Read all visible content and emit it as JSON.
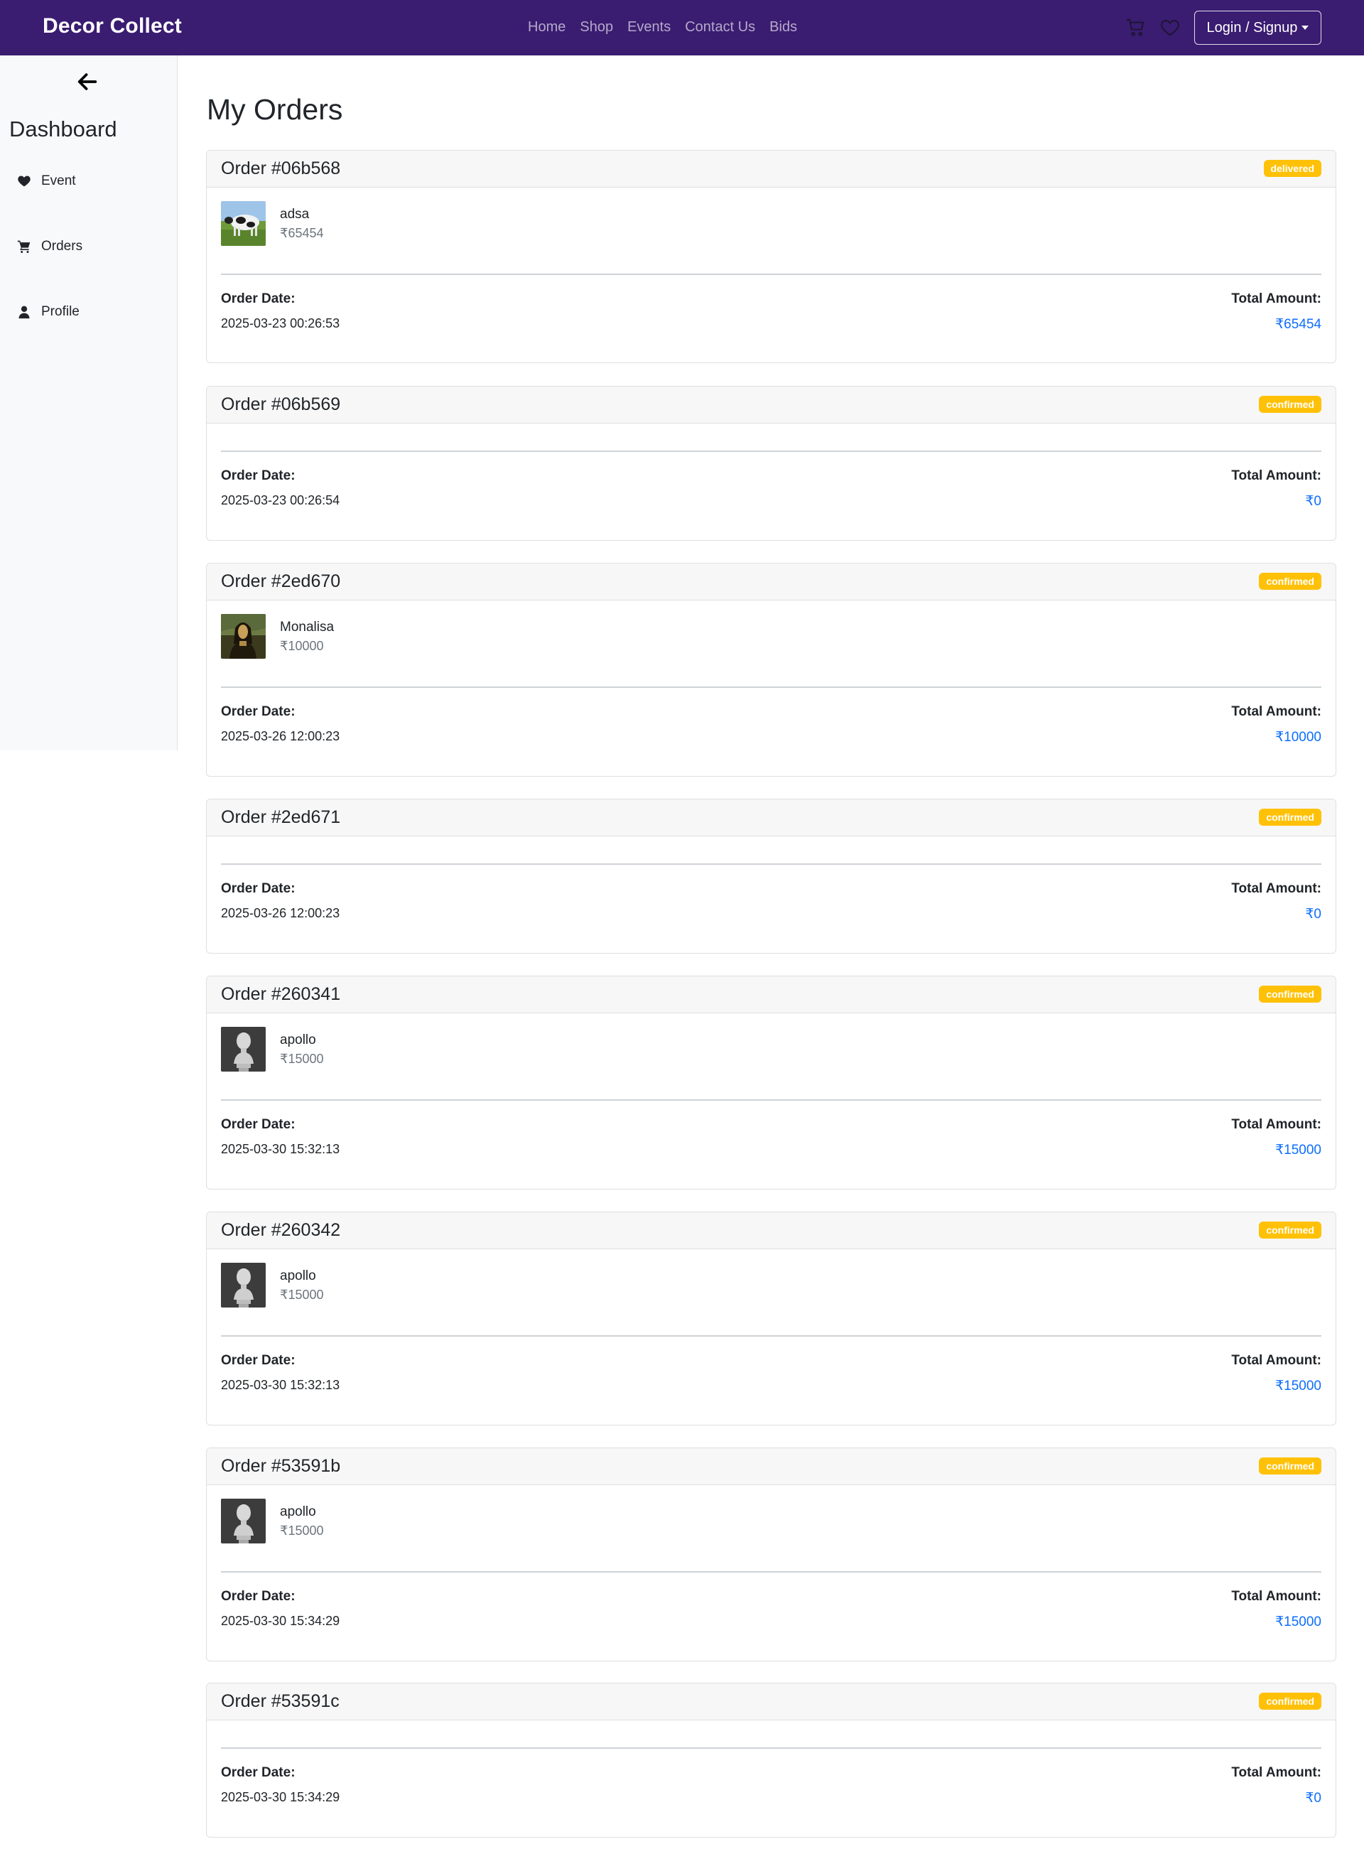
{
  "brand": "Decor Collect",
  "nav": {
    "links": [
      "Home",
      "Shop",
      "Events",
      "Contact Us",
      "Bids"
    ],
    "login_label": "Login / Signup"
  },
  "sidebar": {
    "title": "Dashboard",
    "items": [
      {
        "label": "Event",
        "icon": "heart-icon"
      },
      {
        "label": "Orders",
        "icon": "cart-icon"
      },
      {
        "label": "Profile",
        "icon": "user-icon"
      }
    ]
  },
  "main": {
    "title": "My Orders",
    "date_label": "Order Date:",
    "total_label": "Total Amount:",
    "orders": [
      {
        "id": "Order #06b568",
        "status": "delivered",
        "has_item": true,
        "item": {
          "name": "adsa",
          "price": "₹65454",
          "image": "cow-image"
        },
        "date": "2025-03-23 00:26:53",
        "total": "₹65454"
      },
      {
        "id": "Order #06b569",
        "status": "confirmed",
        "has_item": false,
        "date": "2025-03-23 00:26:54",
        "total": "₹0"
      },
      {
        "id": "Order #2ed670",
        "status": "confirmed",
        "has_item": true,
        "item": {
          "name": "Monalisa",
          "price": "₹10000",
          "image": "monalisa-image"
        },
        "date": "2025-03-26 12:00:23",
        "total": "₹10000"
      },
      {
        "id": "Order #2ed671",
        "status": "confirmed",
        "has_item": false,
        "date": "2025-03-26 12:00:23",
        "total": "₹0"
      },
      {
        "id": "Order #260341",
        "status": "confirmed",
        "has_item": true,
        "item": {
          "name": "apollo",
          "price": "₹15000",
          "image": "apollo-bust-image"
        },
        "date": "2025-03-30 15:32:13",
        "total": "₹15000"
      },
      {
        "id": "Order #260342",
        "status": "confirmed",
        "has_item": true,
        "item": {
          "name": "apollo",
          "price": "₹15000",
          "image": "apollo-bust-image"
        },
        "date": "2025-03-30 15:32:13",
        "total": "₹15000"
      },
      {
        "id": "Order #53591b",
        "status": "confirmed",
        "has_item": true,
        "item": {
          "name": "apollo",
          "price": "₹15000",
          "image": "apollo-bust-image"
        },
        "date": "2025-03-30 15:34:29",
        "total": "₹15000"
      },
      {
        "id": "Order #53591c",
        "status": "confirmed",
        "has_item": false,
        "date": "2025-03-30 15:34:29",
        "total": "₹0"
      }
    ]
  },
  "colors": {
    "navbar": "#3a1c71",
    "badge": "#ffc107",
    "amount": "#0d6efd"
  }
}
